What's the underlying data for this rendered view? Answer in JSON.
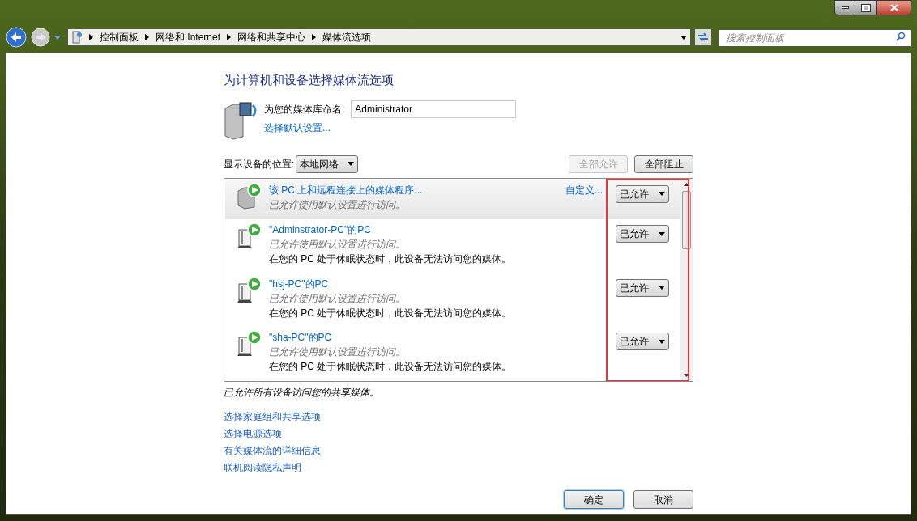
{
  "address_bar": {
    "breadcrumb": [
      "控制面板",
      "网络和 Internet",
      "网络和共享中心",
      "媒体流选项"
    ]
  },
  "search": {
    "placeholder": "搜索控制面板"
  },
  "heading": "为计算机和设备选择媒体流选项",
  "library": {
    "label": "为您的媒体库命名:",
    "value": "Administrator",
    "link": "选择默认设置..."
  },
  "location": {
    "label": "显示设备的位置:",
    "value": "本地网络"
  },
  "buttons_top": [
    {
      "label": "全部允许",
      "disabled": true
    },
    {
      "label": "全部阻止",
      "disabled": false
    }
  ],
  "devices": [
    {
      "kind": "program",
      "name": "该 PC 上和远程连接上的媒体程序...",
      "status": "已允许使用默认设置进行访问。",
      "customize": "自定义...",
      "access": "已允许",
      "selected": true
    },
    {
      "kind": "pc",
      "name": "\"Adminstrator-PC\"的PC",
      "status": "已允许使用默认设置进行访问。",
      "note": "在您的 PC 处于休眠状态时，此设备无法访问您的媒体。",
      "access": "已允许",
      "selected": false
    },
    {
      "kind": "pc",
      "name": "\"hsj-PC\"的PC",
      "status": "已允许使用默认设置进行访问。",
      "note": "在您的 PC 处于休眠状态时，此设备无法访问您的媒体。",
      "access": "已允许",
      "selected": false
    },
    {
      "kind": "pc",
      "name": "\"sha-PC\"的PC",
      "status": "已允许使用默认设置进行访问。",
      "note": "在您的 PC 处于休眠状态时，此设备无法访问您的媒体。",
      "access": "已允许",
      "selected": false
    }
  ],
  "summary": "已允许所有设备访问您的共享媒体。",
  "links": [
    "选择家庭组和共享选项",
    "选择电源选项",
    "有关媒体流的详细信息",
    "联机阅读隐私声明"
  ],
  "buttons_bottom": [
    {
      "label": "确定",
      "default": true
    },
    {
      "label": "取消",
      "default": false
    }
  ]
}
